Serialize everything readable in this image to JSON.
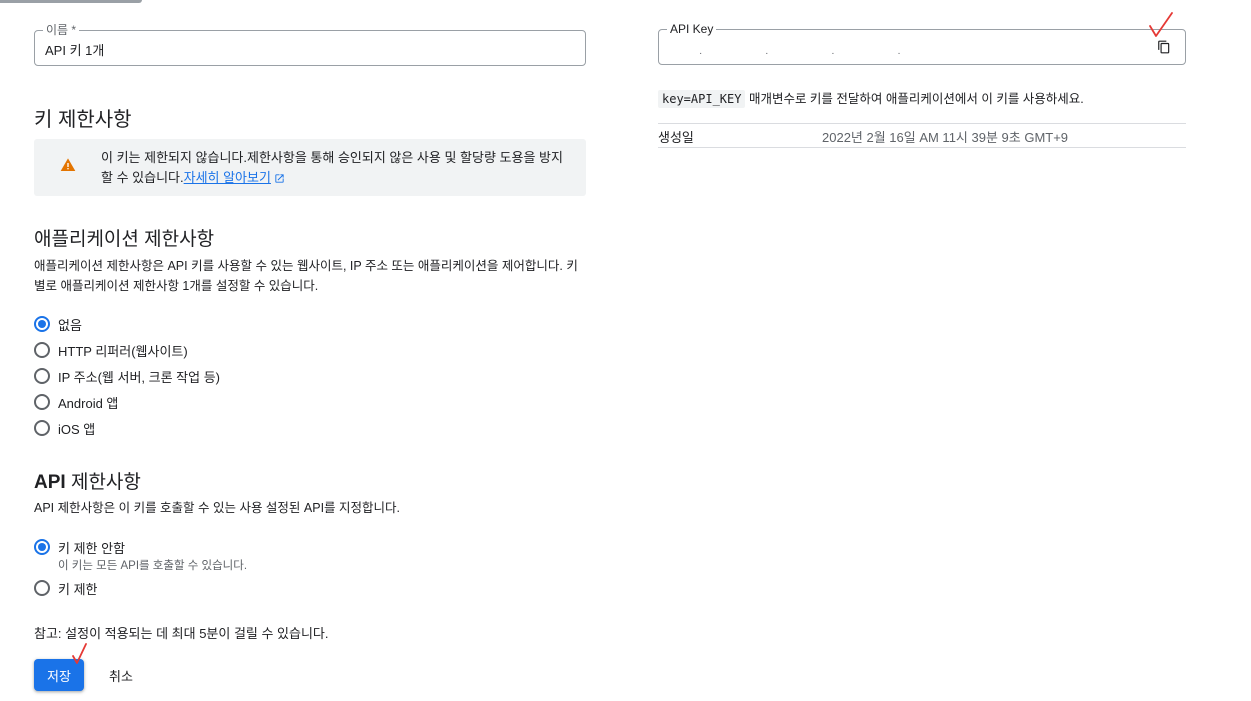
{
  "name_field": {
    "label": "이름 *",
    "value": "API 키 1개"
  },
  "key_restrictions": {
    "title": "키 제한사항",
    "warning_text": "이 키는 제한되지 않습니다.제한사항을 통해 승인되지 않은 사용 및 할당량 도용을 방지할 수 있습니다.",
    "warning_link": "자세히 알아보기",
    "warning_icon": "warning-icon"
  },
  "app_restrictions": {
    "title": "애플리케이션 제한사항",
    "description": "애플리케이션 제한사항은 API 키를 사용할 수 있는 웹사이트, IP 주소 또는 애플리케이션을 제어합니다. 키별로 애플리케이션 제한사항 1개를 설정할 수 있습니다.",
    "options": [
      "없음",
      "HTTP 리퍼러(웹사이트)",
      "IP 주소(웹 서버, 크론 작업 등)",
      "Android 앱",
      "iOS 앱"
    ],
    "selected": "없음"
  },
  "api_restrictions": {
    "title_bold": "API",
    "title_rest": " 제한사항",
    "description": "API 제한사항은 이 키를 호출할 수 있는 사용 설정된 API를 지정합니다.",
    "options": [
      {
        "label": "키 제한 안함",
        "sub": "이 키는 모든 API를 호출할 수 있습니다."
      },
      {
        "label": "키 제한",
        "sub": ""
      }
    ],
    "selected": "키 제한 안함"
  },
  "note": "참고: 설정이 적용되는 데 최대 5분이 걸릴 수 있습니다.",
  "buttons": {
    "save": "저장",
    "cancel": "취소"
  },
  "api_key": {
    "label": "API Key",
    "masked_value": "· · · ·",
    "copy_icon": "copy-icon",
    "usage_code": "key=API_KEY",
    "usage_text": " 매개변수로 키를 전달하여 애플리케이션에서 이 키를 사용하세요."
  },
  "created": {
    "label": "생성일",
    "value": "2022년 2월 16일 AM 11시 39분 9초 GMT+9"
  },
  "colors": {
    "accent": "#1a73e8",
    "warning": "#e37400",
    "annotation": "#e53935"
  }
}
